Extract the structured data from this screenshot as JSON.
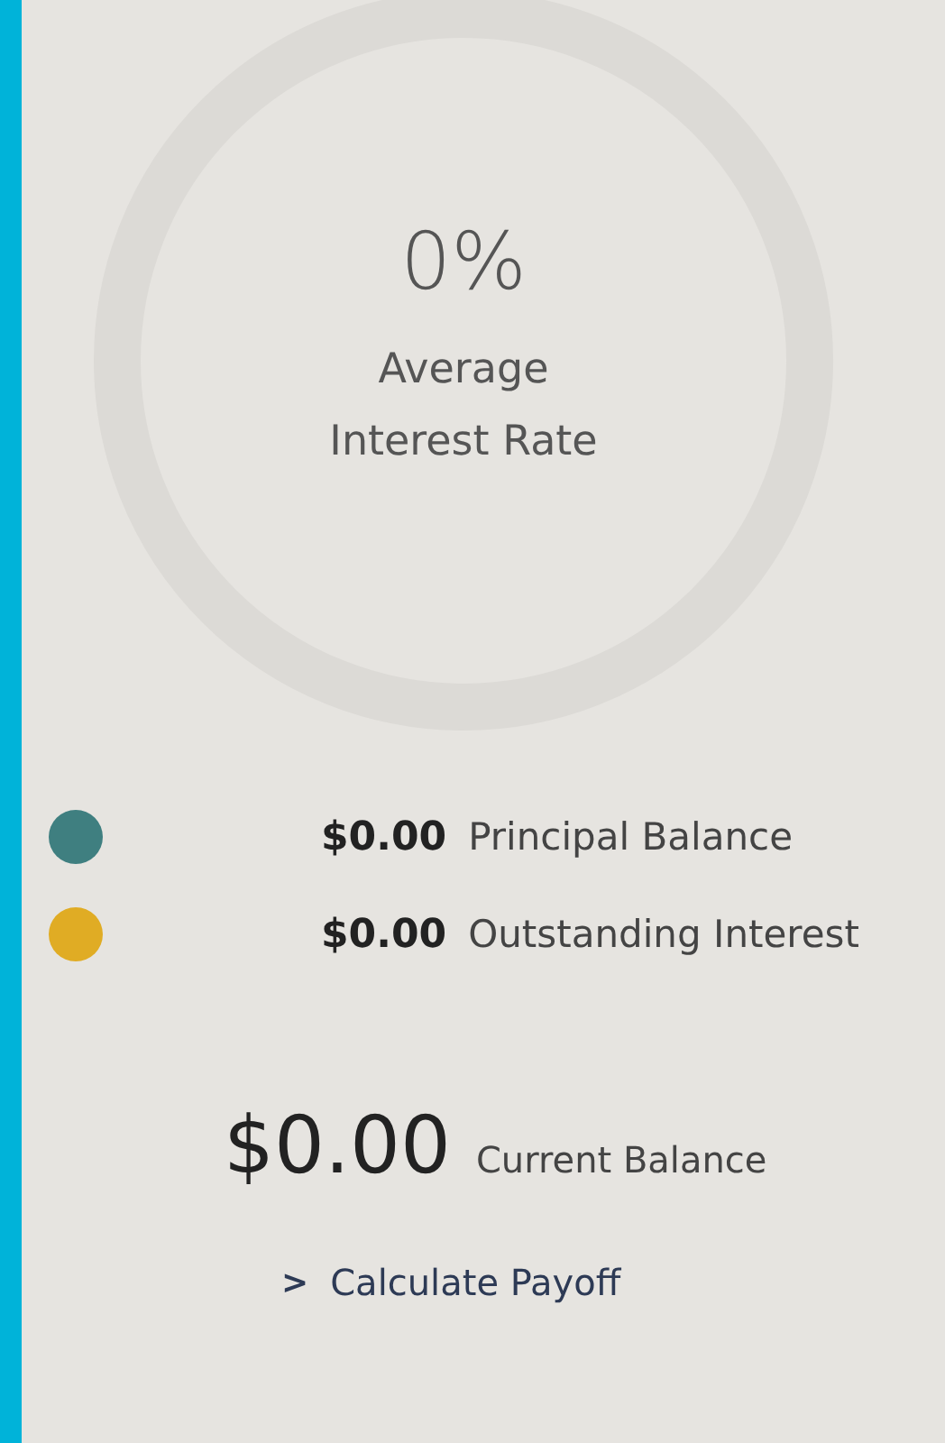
{
  "summary": {
    "rate": "0%",
    "rate_label_lines": [
      "Average",
      "Interest Rate"
    ]
  },
  "legend": [
    {
      "amount": "$0.00",
      "label": "Principal Balance",
      "color": "#3f7f80"
    },
    {
      "amount": "$0.00",
      "label": "Outstanding Interest",
      "color": "#e0ac24"
    }
  ],
  "current_balance": {
    "amount": "$0.00",
    "label": "Current Balance"
  },
  "payoff_link": {
    "chevron": ">",
    "label": "Calculate Payoff"
  }
}
